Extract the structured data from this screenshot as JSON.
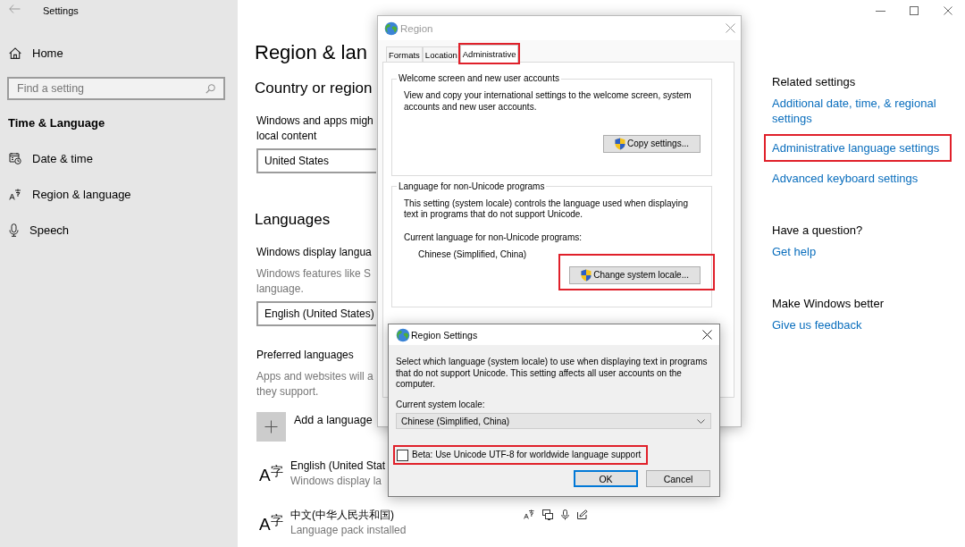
{
  "window": {
    "title": "Settings"
  },
  "sidebar": {
    "home": "Home",
    "search": {
      "placeholder": "Find a setting"
    },
    "section": "Time & Language",
    "items": [
      {
        "label": "Date & time"
      },
      {
        "label": "Region & language"
      },
      {
        "label": "Speech"
      }
    ]
  },
  "page": {
    "title": "Region & lan",
    "country": {
      "heading": "Country or region",
      "description": [
        "Windows and apps migh",
        "local content"
      ],
      "value": "United States"
    },
    "languages": {
      "heading": "Languages",
      "display_label": "Windows display langua",
      "display_description": [
        "Windows features like S",
        "language."
      ],
      "display_value": "English (United States)",
      "preferred_label": "Preferred languages",
      "preferred_description": [
        "Apps and websites will a",
        "they support."
      ],
      "add_label": "Add a language",
      "items": [
        {
          "symbol": "A$^{字}$",
          "name": "English (United Stat",
          "detail": "Windows display la",
          "features_visible": false
        },
        {
          "symbol": "A$^{字}$",
          "name": "中文(中华人民共和国)",
          "detail": "Language pack installed",
          "features_visible": true
        }
      ]
    }
  },
  "related": [
    {
      "heading": "Related settings",
      "links": [
        {
          "label": "Additional date, time, & regional settings",
          "highlighted": false
        },
        {
          "label": "Administrative language settings",
          "highlighted": true
        },
        {
          "label": "Advanced keyboard settings",
          "highlighted": false
        }
      ]
    },
    {
      "heading": "Have a question?",
      "links": [
        {
          "label": "Get help",
          "highlighted": false
        }
      ]
    },
    {
      "heading": "Make Windows better",
      "links": [
        {
          "label": "Give us feedback",
          "highlighted": false
        }
      ]
    }
  ],
  "region_dialog": {
    "title": "Region",
    "active": false,
    "tabs": [
      {
        "label": "Formats",
        "selected": false,
        "highlighted": false
      },
      {
        "label": "Location",
        "selected": false,
        "highlighted": false
      },
      {
        "label": "Administrative",
        "selected": true,
        "highlighted": true
      }
    ],
    "groups": [
      {
        "title": "Welcome screen and new user accounts",
        "text": "View and copy your international settings to the welcome screen, system accounts and new user accounts.",
        "button": {
          "label": "Copy settings...",
          "highlighted": false
        }
      },
      {
        "title": "Language for non-Unicode programs",
        "text": "This setting (system locale) controls the language used when displaying text in programs that do not support Unicode.",
        "current_label": "Current language for non-Unicode programs:",
        "current_value": "Chinese (Simplified, China)",
        "button": {
          "label": "Change system locale...",
          "highlighted": true
        }
      }
    ]
  },
  "locale_dialog": {
    "title": "Region Settings",
    "active": true,
    "text": "Select which language (system locale) to use when displaying text in programs that do not support Unicode. This setting affects all user accounts on the computer.",
    "locale_label": "Current system locale:",
    "locale_value": "Chinese (Simplified, China)",
    "beta": {
      "label": "Beta: Use Unicode UTF-8 for worldwide language support",
      "checked": false,
      "highlighted": true
    },
    "buttons": [
      {
        "label": "OK",
        "focused": true
      },
      {
        "label": "Cancel",
        "focused": false
      }
    ]
  }
}
